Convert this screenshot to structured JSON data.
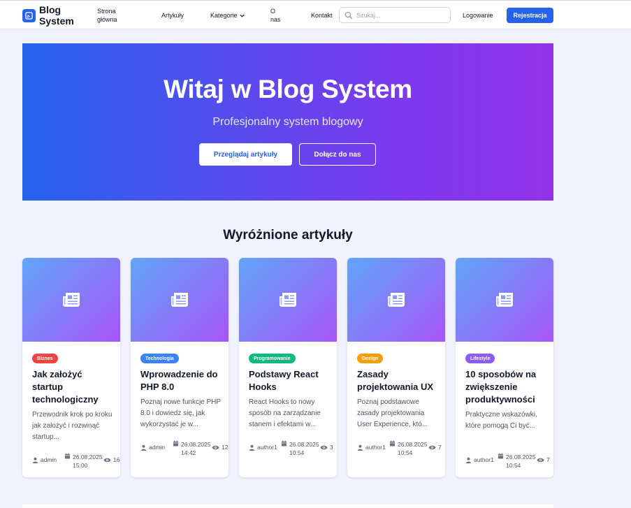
{
  "nav": {
    "brand": "Blog System",
    "links": {
      "home": "Strona główna",
      "articles": "Artykuły",
      "categories": "Kategorie",
      "about": "O nas",
      "contact": "Kontakt"
    },
    "search_placeholder": "Szukaj...",
    "login": "Logowanie",
    "register": "Rejestracja"
  },
  "hero": {
    "title": "Witaj w Blog System",
    "subtitle": "Profesjonalny system blogowy",
    "primary_button": "Przeglądaj artykuły",
    "secondary_button": "Dołącz do nas"
  },
  "featured": {
    "title": "Wyróżnione artykuły",
    "cards": [
      {
        "category": "Biznes",
        "category_color": "#ef4444",
        "title": "Jak założyć startup technologiczny",
        "excerpt": "Przewodnik krok po kroku jak założyć i rozwinąć startup...",
        "author": "admin",
        "date": "26.08.2025 15:00",
        "views": "16",
        "icon": "newspaper-icon"
      },
      {
        "category": "Technologia",
        "category_color": "#3b82f6",
        "title": "Wprowadzenie do PHP 8.0",
        "excerpt": "Poznaj nowe funkcje PHP 8.0 i dowiedz się, jak wykorzystać je w...",
        "author": "admin",
        "date": "26.08.2025 14:42",
        "views": "12",
        "icon": "newspaper-icon"
      },
      {
        "category": "Programowanie",
        "category_color": "#10b981",
        "title": "Podstawy React Hooks",
        "excerpt": "React Hooks to nowy sposób na zarządzanie stanem i efektami w...",
        "author": "author1",
        "date": "26.08.2025 10:54",
        "views": "3",
        "icon": "newspaper-icon"
      },
      {
        "category": "Design",
        "category_color": "#f59e0b",
        "title": "Zasady projektowania UX",
        "excerpt": "Poznaj podstawowe zasady projektowania User Experience, któ...",
        "author": "author1",
        "date": "26.08.2025 10:54",
        "views": "7",
        "icon": "newspaper-icon"
      },
      {
        "category": "Lifestyle",
        "category_color": "#8b5cf6",
        "title": "10 sposobów na zwiększenie produktywności",
        "excerpt": "Praktyczne wskazówki, które pomogą Ci być...",
        "author": "author1",
        "date": "26.08.2025 10:54",
        "views": "7",
        "icon": "newspaper-icon"
      }
    ]
  }
}
